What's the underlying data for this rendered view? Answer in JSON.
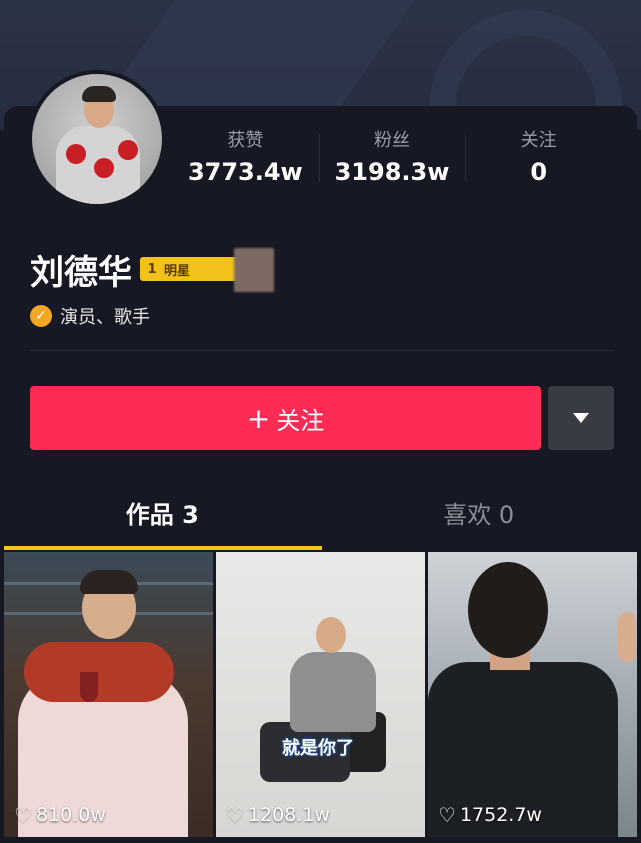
{
  "profile": {
    "name": "刘德华",
    "rank_badge": {
      "rank": "1",
      "label": "明星"
    },
    "verification": "演员、歌手"
  },
  "stats": [
    {
      "label": "获赞",
      "value": "3773.4w"
    },
    {
      "label": "粉丝",
      "value": "3198.3w"
    },
    {
      "label": "关注",
      "value": "0"
    }
  ],
  "actions": {
    "follow_label": "关注",
    "follow_plus": "+"
  },
  "tabs": [
    {
      "label": "作品 3",
      "active": true
    },
    {
      "label": "喜欢 0",
      "active": false
    }
  ],
  "videos": [
    {
      "likes": "810.0w"
    },
    {
      "likes": "1208.1w",
      "caption": "就是你了"
    },
    {
      "likes": "1752.7w"
    }
  ],
  "colors": {
    "background": "#161823",
    "follow_button": "#fe2c55",
    "tab_underline": "#f5c518",
    "rank_badge": "#f3c21a",
    "verify_badge": "#f5a623"
  }
}
